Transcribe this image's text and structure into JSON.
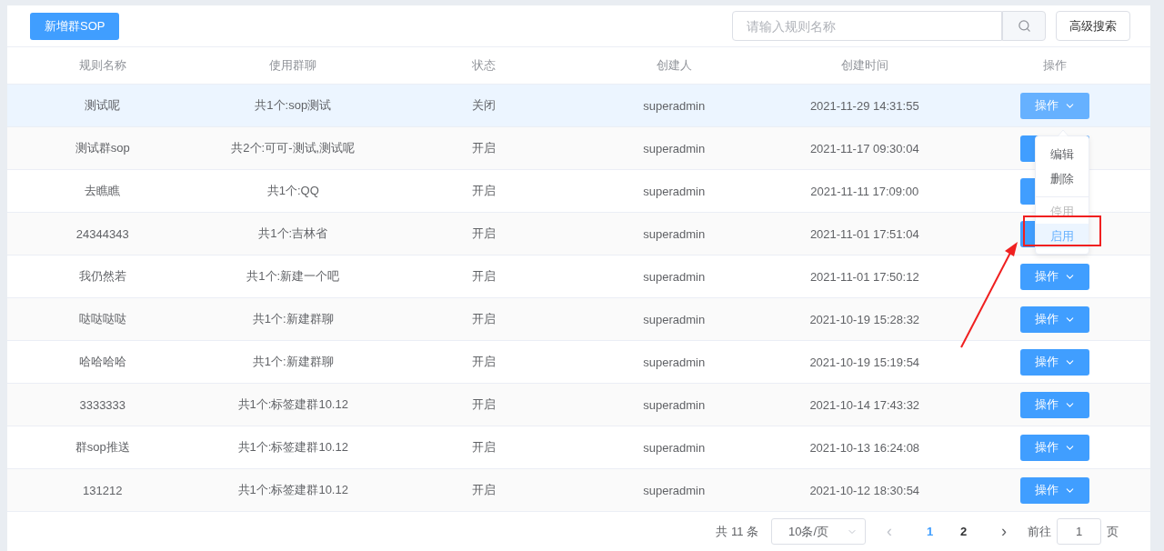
{
  "toolbar": {
    "add_button": "新增群SOP",
    "search": {
      "placeholder": "请输入规则名称"
    },
    "advanced_button": "高级搜索"
  },
  "table": {
    "columns": [
      "规则名称",
      "使用群聊",
      "状态",
      "创建人",
      "创建时间",
      "操作"
    ],
    "rows": [
      {
        "name": "测试呢",
        "groups": "共1个:sop测试",
        "status": "关闭",
        "creator": "superadmin",
        "created": "2021-11-29 14:31:55",
        "action": "操作",
        "selected": true
      },
      {
        "name": "测试群sop",
        "groups": "共2个:可可-测试,测试呢",
        "status": "开启",
        "creator": "superadmin",
        "created": "2021-11-17 09:30:04",
        "selected": false
      },
      {
        "name": "去瞧瞧",
        "groups": "共1个:QQ",
        "status": "开启",
        "creator": "superadmin",
        "created": "2021-11-11 17:09:00",
        "selected": false
      },
      {
        "name": "24344343",
        "groups": "共1个:吉林省",
        "status": "开启",
        "creator": "superadmin",
        "created": "2021-11-01 17:51:04",
        "selected": false
      },
      {
        "name": "我仍然若",
        "groups": "共1个:新建一个吧",
        "status": "开启",
        "creator": "superadmin",
        "created": "2021-11-01 17:50:12",
        "action": "操作",
        "selected": false
      },
      {
        "name": "哒哒哒哒",
        "groups": "共1个:新建群聊",
        "status": "开启",
        "creator": "superadmin",
        "created": "2021-10-19 15:28:32",
        "action": "操作",
        "selected": false
      },
      {
        "name": "哈哈哈哈",
        "groups": "共1个:新建群聊",
        "status": "开启",
        "creator": "superadmin",
        "created": "2021-10-19 15:19:54",
        "action": "操作",
        "selected": false
      },
      {
        "name": "3333333",
        "groups": "共1个:标签建群10.12",
        "status": "开启",
        "creator": "superadmin",
        "created": "2021-10-14 17:43:32",
        "action": "操作",
        "selected": false
      },
      {
        "name": "群sop推送",
        "groups": "共1个:标签建群10.12",
        "status": "开启",
        "creator": "superadmin",
        "created": "2021-10-13 16:24:08",
        "action": "操作",
        "selected": false
      },
      {
        "name": "131212",
        "groups": "共1个:标签建群10.12",
        "status": "开启",
        "creator": "superadmin",
        "created": "2021-10-12 18:30:54",
        "action": "操作",
        "selected": false
      }
    ]
  },
  "action_menu": {
    "items": [
      {
        "label": "编辑",
        "disabled": false,
        "divided": false,
        "highlighted": false
      },
      {
        "label": "删除",
        "disabled": false,
        "divided": false,
        "highlighted": false
      },
      {
        "label": "停用",
        "disabled": true,
        "divided": true,
        "highlighted": false
      },
      {
        "label": "启用",
        "disabled": false,
        "divided": false,
        "highlighted": true
      }
    ]
  },
  "pagination": {
    "total": "共 11 条",
    "page_size": "10条/页",
    "prev": "‹",
    "pages": [
      {
        "label": "1",
        "selected": true
      },
      {
        "label": "2",
        "selected": false
      }
    ],
    "next": "›",
    "goto_label": "前往",
    "goto_value": "1",
    "page_suffix": "页"
  }
}
